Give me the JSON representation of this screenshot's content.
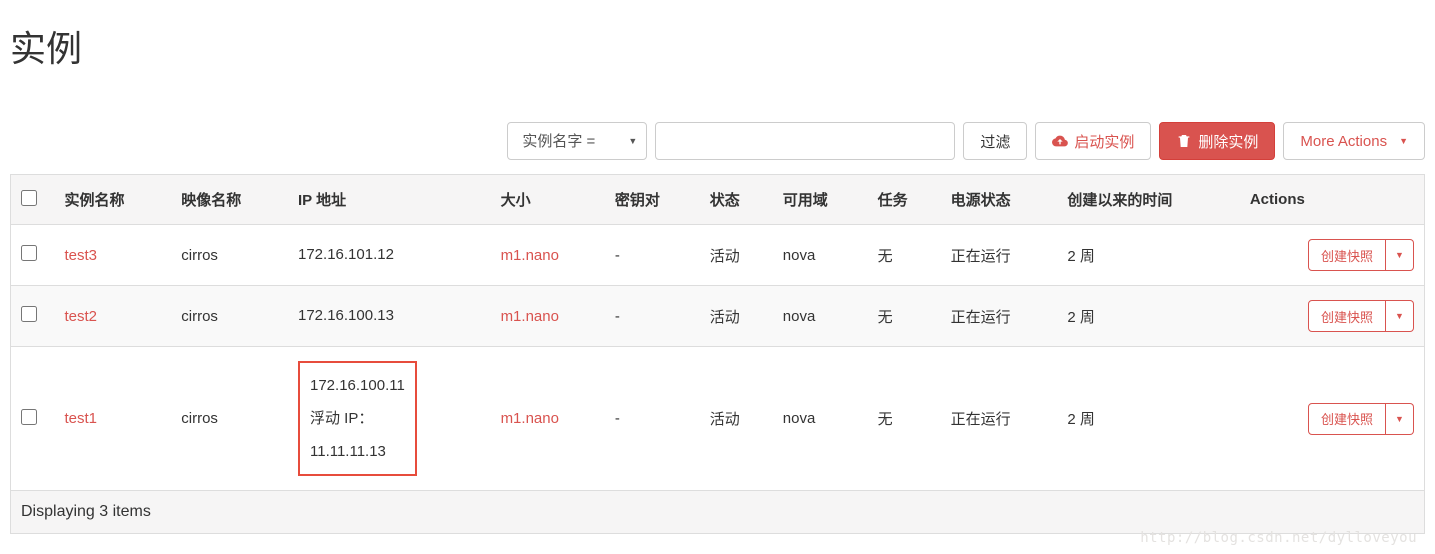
{
  "page": {
    "title": "实例"
  },
  "toolbar": {
    "filter_select": "实例名字 =",
    "filter_button": "过滤",
    "launch_button": "启动实例",
    "delete_button": "删除实例",
    "more_actions": "More Actions"
  },
  "table": {
    "headers": {
      "name": "实例名称",
      "image": "映像名称",
      "ip": "IP 地址",
      "size": "大小",
      "keypair": "密钥对",
      "status": "状态",
      "zone": "可用域",
      "task": "任务",
      "power": "电源状态",
      "age": "创建以来的时间",
      "actions": "Actions"
    },
    "rows": [
      {
        "name": "test3",
        "image": "cirros",
        "ip": "172.16.101.12",
        "size": "m1.nano",
        "keypair": "-",
        "status": "活动",
        "zone": "nova",
        "task": "无",
        "power": "正在运行",
        "age": "2 周",
        "action_label": "创建快照",
        "highlighted": false
      },
      {
        "name": "test2",
        "image": "cirros",
        "ip": "172.16.100.13",
        "size": "m1.nano",
        "keypair": "-",
        "status": "活动",
        "zone": "nova",
        "task": "无",
        "power": "正在运行",
        "age": "2 周",
        "action_label": "创建快照",
        "highlighted": false
      },
      {
        "name": "test1",
        "image": "cirros",
        "ip": "172.16.100.11",
        "floating_ip_label": "浮动 IP：",
        "floating_ip": "11.11.11.13",
        "size": "m1.nano",
        "keypair": "-",
        "status": "活动",
        "zone": "nova",
        "task": "无",
        "power": "正在运行",
        "age": "2 周",
        "action_label": "创建快照",
        "highlighted": true
      }
    ],
    "footer": "Displaying 3 items"
  },
  "watermark": "http://blog.csdn.net/dylloveyou"
}
